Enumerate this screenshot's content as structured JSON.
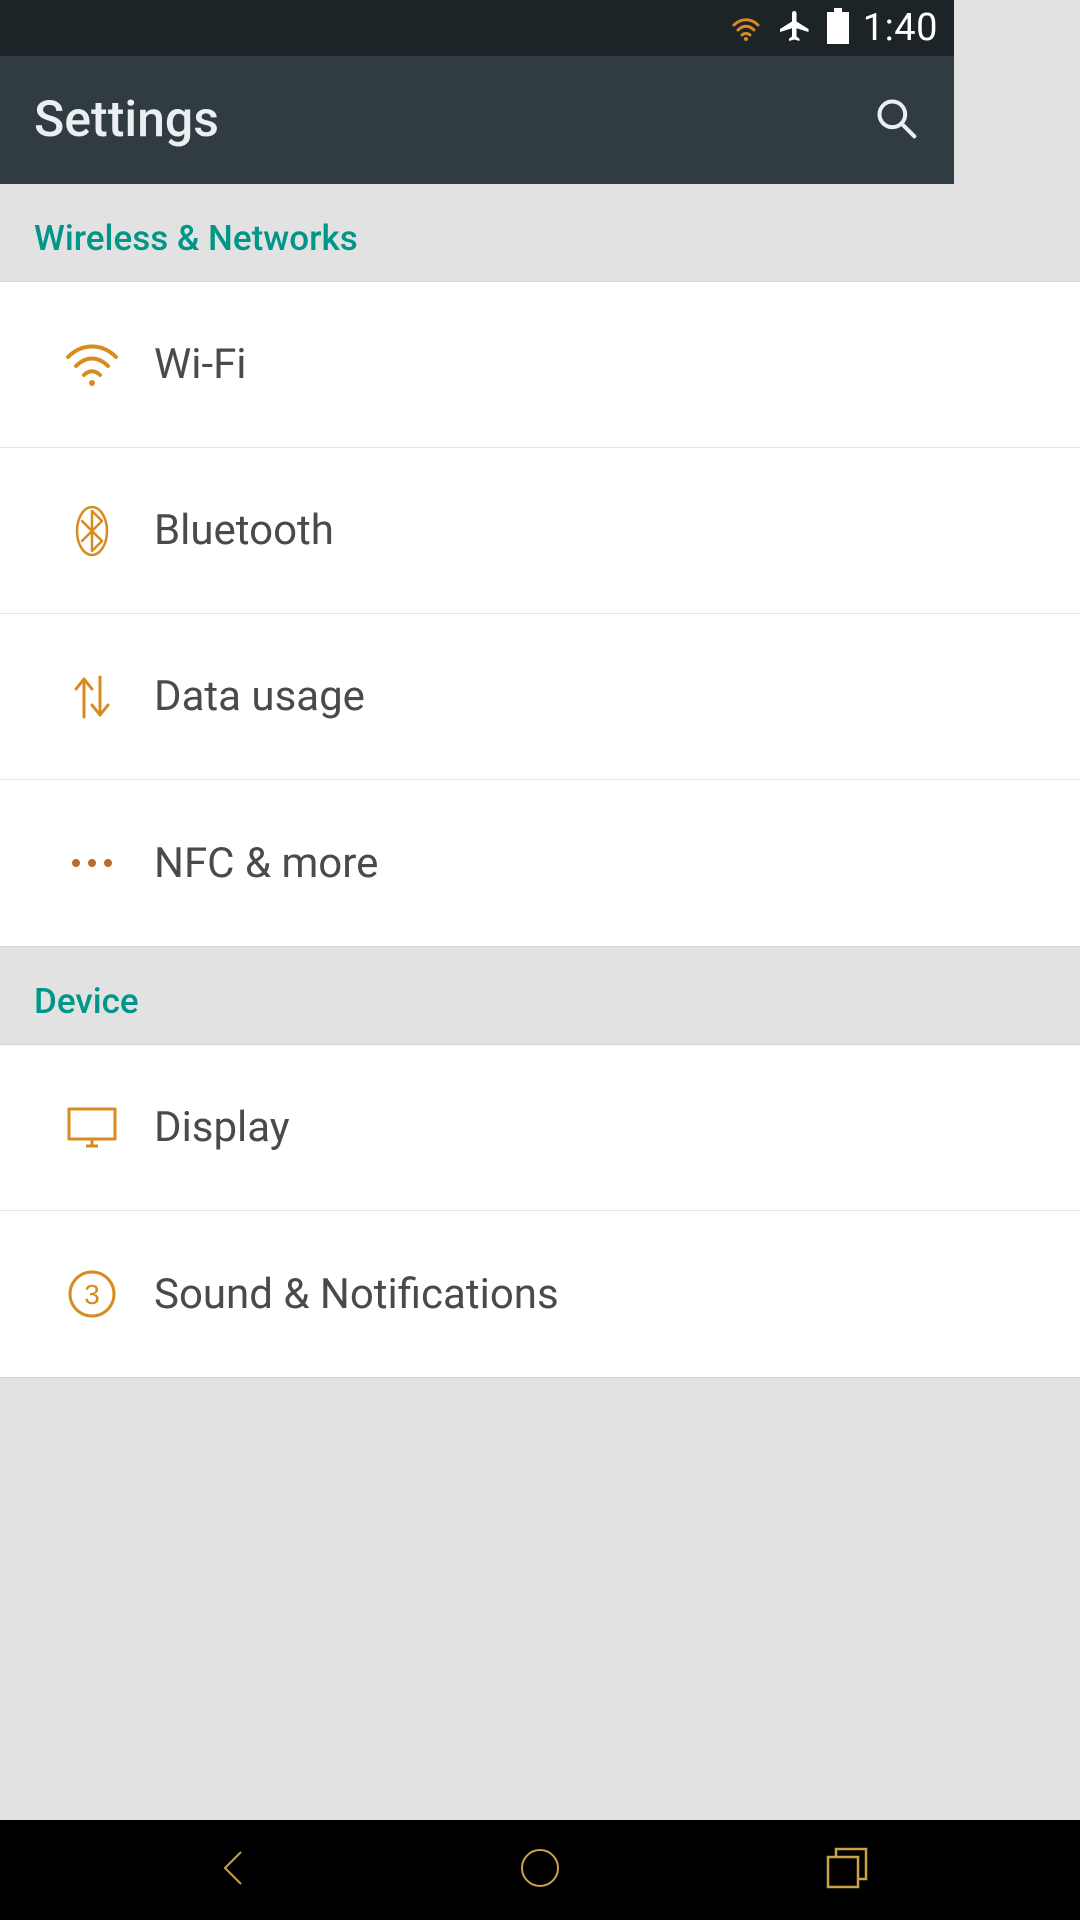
{
  "status": {
    "time": "1:40"
  },
  "appbar": {
    "title": "Settings"
  },
  "sections": [
    {
      "header": "Wireless & Networks",
      "items": [
        {
          "icon": "wifi",
          "label": "Wi-Fi"
        },
        {
          "icon": "bluetooth",
          "label": "Bluetooth"
        },
        {
          "icon": "data",
          "label": "Data usage"
        },
        {
          "icon": "more",
          "label": "NFC & more"
        }
      ]
    },
    {
      "header": "Device",
      "items": [
        {
          "icon": "display",
          "label": "Display"
        },
        {
          "icon": "sound",
          "label": "Sound & Notifications"
        }
      ]
    }
  ],
  "colors": {
    "accent": "#d88b1f",
    "teal": "#009688"
  }
}
